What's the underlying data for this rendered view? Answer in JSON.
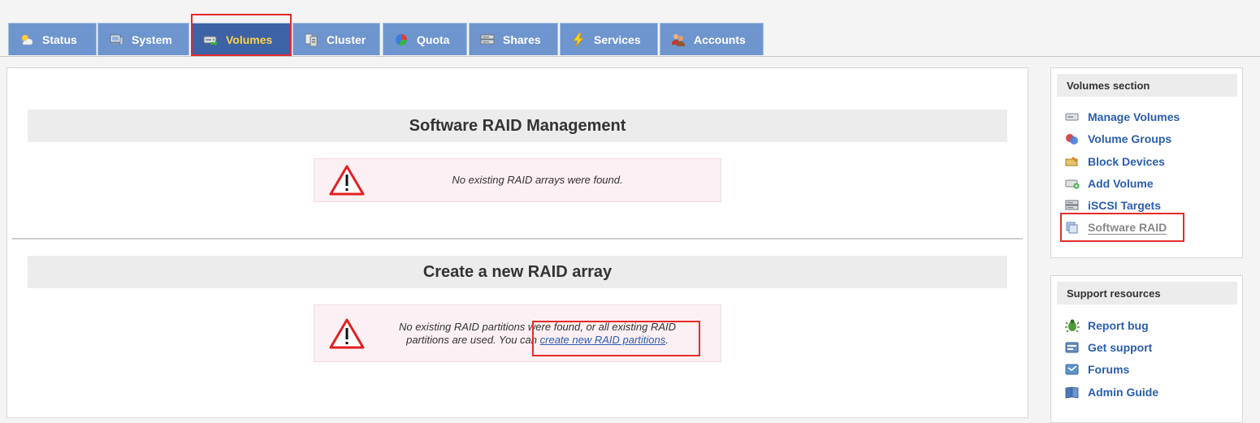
{
  "tabs": [
    {
      "label": "Status",
      "icon": "weather-icon"
    },
    {
      "label": "System",
      "icon": "computer-icon"
    },
    {
      "label": "Volumes",
      "icon": "drive-icon",
      "active": true
    },
    {
      "label": "Cluster",
      "icon": "cluster-icon"
    },
    {
      "label": "Quota",
      "icon": "pie-chart-icon"
    },
    {
      "label": "Shares",
      "icon": "server-icon"
    },
    {
      "label": "Services",
      "icon": "lightning-icon"
    },
    {
      "label": "Accounts",
      "icon": "users-icon"
    }
  ],
  "main": {
    "raid_management": {
      "title": "Software RAID Management",
      "message": "No existing RAID arrays were found."
    },
    "create_raid": {
      "title": "Create a new RAID array",
      "message_line1": "No existing RAID partitions were found, or all existing RAID",
      "message_line2_prefix": "partitions are used. You can ",
      "link_text": "create new RAID partitions",
      "message_suffix": "."
    }
  },
  "sidebar": {
    "volumes": {
      "header": "Volumes section",
      "items": [
        {
          "label": "Manage Volumes",
          "icon": "drive-icon"
        },
        {
          "label": "Volume Groups",
          "icon": "volume-groups-icon"
        },
        {
          "label": "Block Devices",
          "icon": "block-devices-icon"
        },
        {
          "label": "Add Volume",
          "icon": "add-volume-icon"
        },
        {
          "label": "iSCSI Targets",
          "icon": "iscsi-icon"
        },
        {
          "label": "Software RAID",
          "icon": "raid-icon",
          "current": true
        }
      ]
    },
    "support": {
      "header": "Support resources",
      "items": [
        {
          "label": "Report bug",
          "icon": "bug-icon"
        },
        {
          "label": "Get support",
          "icon": "support-icon"
        },
        {
          "label": "Forums",
          "icon": "forums-icon"
        },
        {
          "label": "Admin Guide",
          "icon": "book-icon"
        }
      ]
    }
  },
  "colors": {
    "tab_bg": "#6f95cf",
    "tab_active_bg": "#3d62a5",
    "tab_active_text": "#ffd24a",
    "link": "#2a5db0",
    "highlight": "#e52b2b",
    "message_bg": "#fdf0f4"
  }
}
